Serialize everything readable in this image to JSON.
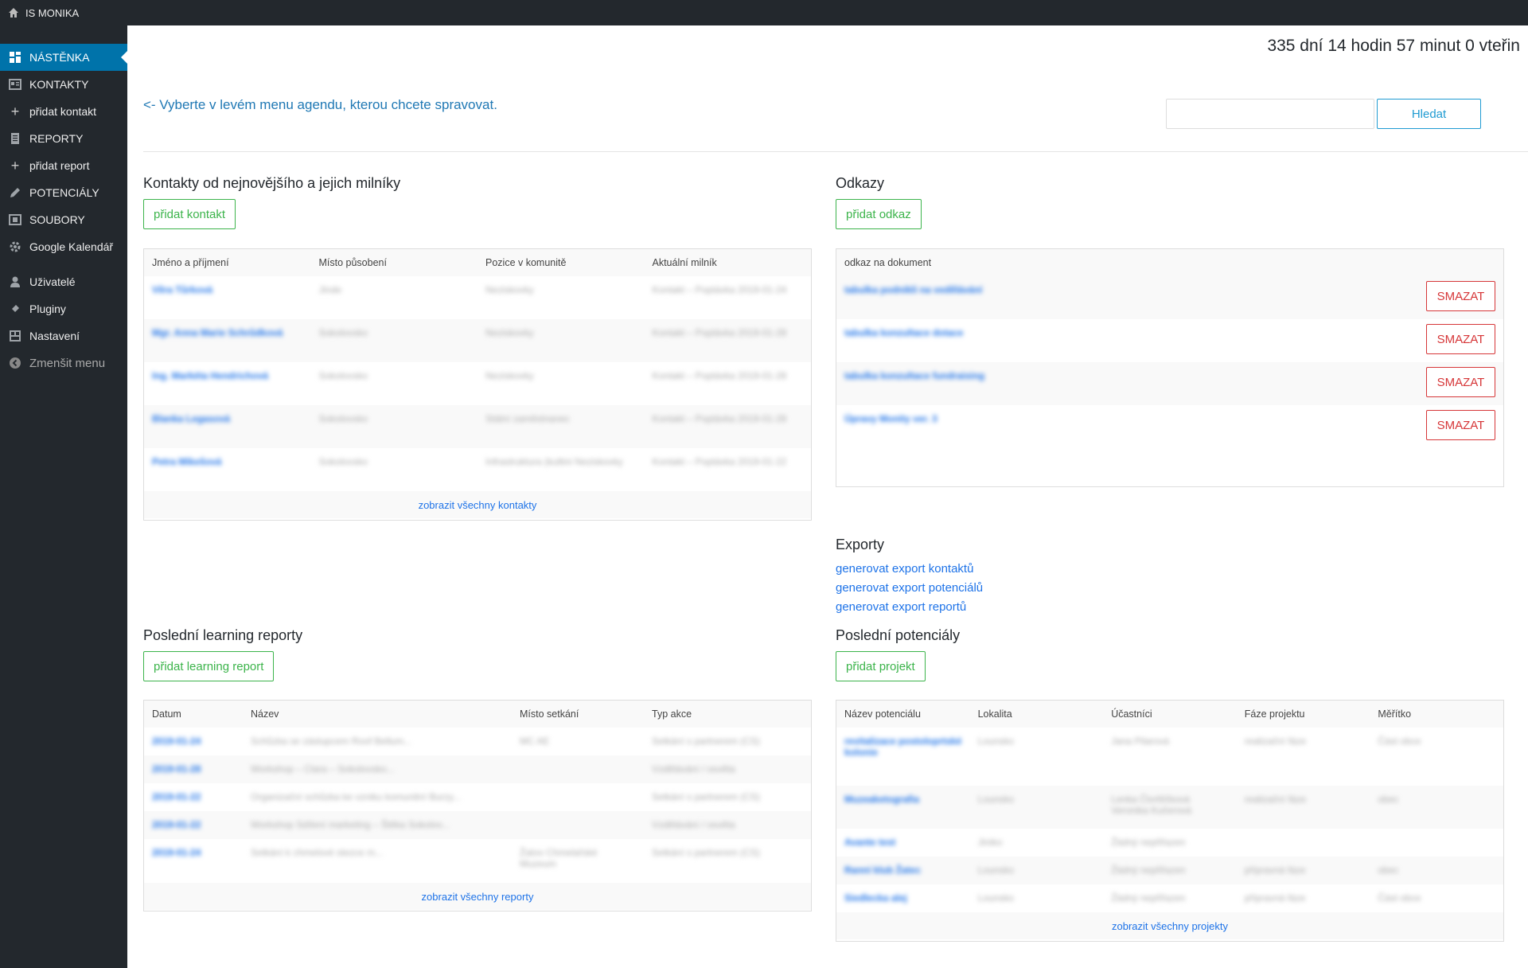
{
  "topbar": {
    "site_name": "IS MONIKA",
    "home_icon": "home-icon"
  },
  "sidebar": {
    "items": [
      {
        "label": "NÁSTĚNKA",
        "icon": "dashboard-icon",
        "active": true
      },
      {
        "label": "KONTAKTY",
        "icon": "contacts-icon"
      },
      {
        "label": "přidat kontakt",
        "icon": "plus-icon"
      },
      {
        "label": "REPORTY",
        "icon": "document-icon"
      },
      {
        "label": "přidat report",
        "icon": "plus-icon"
      },
      {
        "label": "POTENCIÁLY",
        "icon": "pencil-icon"
      },
      {
        "label": "SOUBORY",
        "icon": "files-icon"
      },
      {
        "label": "Google Kalendář",
        "icon": "gear-icon"
      },
      {
        "label": "Uživatelé",
        "icon": "user-icon"
      },
      {
        "label": "Pluginy",
        "icon": "plugin-icon"
      },
      {
        "label": "Nastavení",
        "icon": "settings-icon"
      },
      {
        "label": "Zmenšit menu",
        "icon": "collapse-icon"
      }
    ]
  },
  "header": {
    "countdown": "335 dní 14 hodin 57 minut 0 vteřin",
    "agenda_hint": "<- Vyberte v levém menu agendu, kterou chcete spravovat.",
    "search_placeholder": "",
    "search_button": "Hledat"
  },
  "contacts": {
    "title": "Kontakty od nejnovějšího a jejich milníky",
    "add_button": "přidat kontakt",
    "columns": [
      "Jméno a příjmení",
      "Místo působení",
      "Pozice v komunitě",
      "Aktuální milník"
    ],
    "rows": [
      [
        "Věra Tůrková",
        "Jinde",
        "Neziskovky",
        "Kontakt – Poptávka 2019-01-24"
      ],
      [
        "Mgr. Anna Marie Schrůdková",
        "Sokolovsko",
        "Neziskovky",
        "Kontakt – Poptávka 2019-01-28"
      ],
      [
        "Ing. Markéta Hendrichová",
        "Sokolovsko",
        "Neziskovky",
        "Kontakt – Poptávka 2019-01-28"
      ],
      [
        "Blanka Legasová",
        "Sokolovsko",
        "Státní zaměstnanec",
        "Kontakt – Poptávka 2019-01-28"
      ],
      [
        "Petra Mikešová",
        "Sokolovsko",
        "Infrastruktura (kultini Neziskovky",
        "Kontakt – Poptávka 2019-01-22"
      ]
    ],
    "footer_link": "zobrazit všechny kontakty"
  },
  "links": {
    "title": "Odkazy",
    "add_button": "přidat odkaz",
    "column": "odkaz na dokument",
    "rows": [
      "tabulka podnikli na vedělávání",
      "tabulka konzultace dotace",
      "tabulka konzultace fundraising",
      "Úpravy Monity ver. 3"
    ],
    "delete_label": "SMAZAT"
  },
  "exports": {
    "title": "Exporty",
    "links": [
      "generovat export kontaktů",
      "generovat export potenciálů",
      "generovat export reportů"
    ]
  },
  "reports": {
    "title": "Poslední learning reporty",
    "add_button": "přidat learning report",
    "columns": [
      "Datum",
      "Název",
      "Místo setkání",
      "Typ akce"
    ],
    "rows": [
      [
        "2019-01-24",
        "Schůzka se zástupcem Roof Bellum...",
        "MC AE",
        "Setkání s partnerem (CS)"
      ],
      [
        "2019-01-28",
        "Workshop – Clara – Sokolovsko...",
        "",
        "Vzdělávání / osvěta"
      ],
      [
        "2019-01-22",
        "Organizační schůzka ke vzniku komunitní Burzy...",
        "",
        "Setkání s partnerem (CS)"
      ],
      [
        "2019-01-22",
        "Workshop Sdílení marketing – Štěka Sokolov...",
        "",
        "Vzdělávání / osvěta"
      ],
      [
        "2019-01-24",
        "Setkání k chmelové stezce m...",
        "Žatov Chmelařské Muzeum",
        "Setkání s partnerem (CS)"
      ]
    ],
    "footer_link": "zobrazit všechny reporty"
  },
  "potentials": {
    "title": "Poslední potenciály",
    "add_button": "přidat projekt",
    "columns": [
      "Název potenciálu",
      "Lokalita",
      "Účastníci",
      "Fáze projektu",
      "Měřítko"
    ],
    "rows": [
      [
        "revitalizace postoloprtské kolonie",
        "Lounsko",
        "Jana Pilarová",
        "realizační fáze",
        "Část obce"
      ],
      [
        "Muzeaketografia",
        "Lounsko",
        "Lenka Čtvrtlíčková Veronika Kučerová",
        "realizační fáze",
        "obec"
      ],
      [
        "Avante test",
        "Jiniko",
        "Žádný nepřiřazen",
        "",
        ""
      ],
      [
        "Ranní klub Žatec",
        "Lounsko",
        "Žádný nepřiřazen",
        "přípravná fáze",
        "obec"
      ],
      [
        "Siedlecka alej",
        "Lounsko",
        "Žádný nepřiřazen",
        "přípravná fáze",
        "Část obce"
      ]
    ],
    "footer_link": "zobrazit všechny projekty"
  }
}
